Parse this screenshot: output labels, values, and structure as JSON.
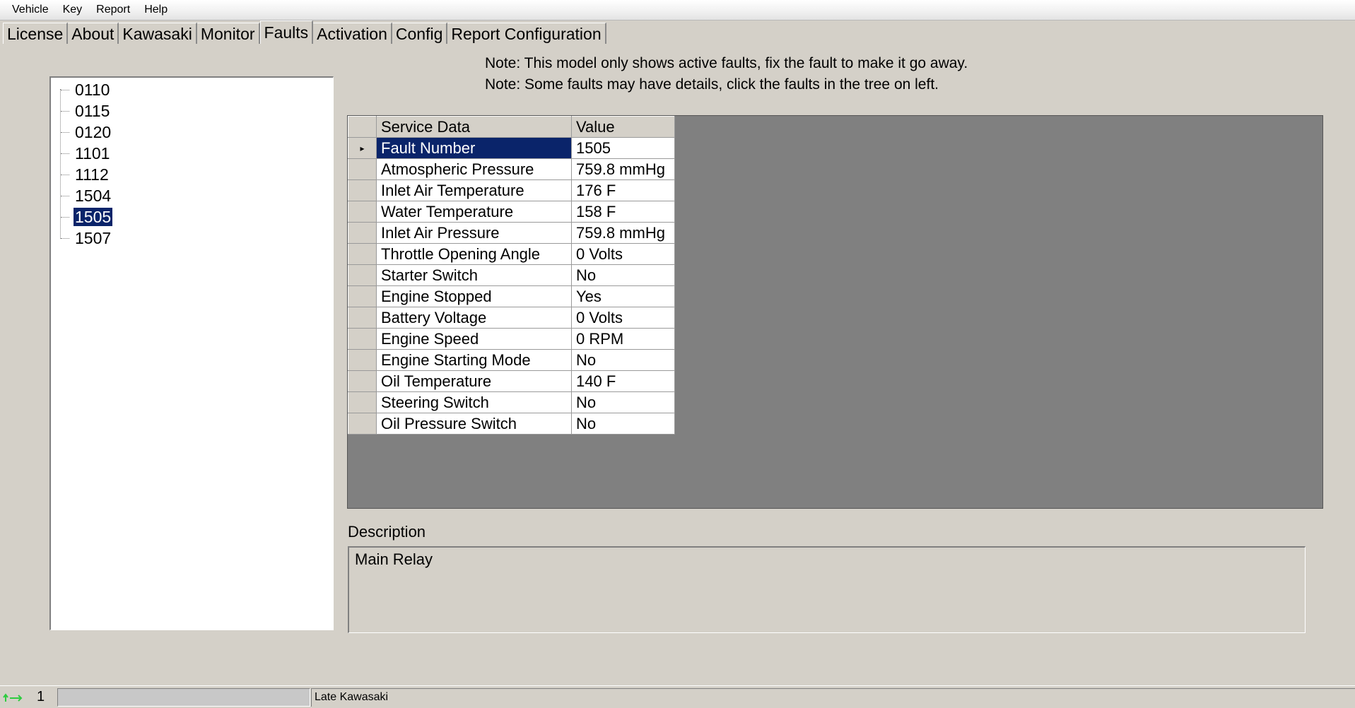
{
  "menu": {
    "items": [
      {
        "label": "Vehicle"
      },
      {
        "label": "Key"
      },
      {
        "label": "Report"
      },
      {
        "label": "Help"
      }
    ]
  },
  "tabs": [
    {
      "label": "License"
    },
    {
      "label": "About"
    },
    {
      "label": "Kawasaki"
    },
    {
      "label": "Monitor"
    },
    {
      "label": "Faults",
      "active": true
    },
    {
      "label": "Activation"
    },
    {
      "label": "Config"
    },
    {
      "label": "Report Configuration"
    }
  ],
  "tree": {
    "nodes": [
      "0110",
      "0115",
      "0120",
      "1101",
      "1112",
      "1504",
      "1505",
      "1507"
    ],
    "selected": "1505"
  },
  "notes": [
    "Note: This model only shows active faults, fix the fault to make it go away.",
    "Note: Some faults may have details, click the faults in the tree on left."
  ],
  "grid": {
    "headers": {
      "service": "Service Data",
      "value": "Value"
    },
    "rows": [
      [
        "Fault Number",
        "1505"
      ],
      [
        "Atmospheric Pressure",
        "759.8 mmHg"
      ],
      [
        "Inlet Air Temperature",
        "176 F"
      ],
      [
        "Water Temperature",
        "158 F"
      ],
      [
        "Inlet Air Pressure",
        "759.8 mmHg"
      ],
      [
        "Throttle Opening Angle",
        "0 Volts"
      ],
      [
        "Starter Switch",
        "No"
      ],
      [
        "Engine Stopped",
        "Yes"
      ],
      [
        "Battery Voltage",
        "0 Volts"
      ],
      [
        "Engine Speed",
        "0 RPM"
      ],
      [
        "Engine Starting Mode",
        "No"
      ],
      [
        "Oil Temperature",
        "140 F"
      ],
      [
        "Steering Switch",
        "No"
      ],
      [
        "Oil Pressure Switch",
        "No"
      ]
    ],
    "selected_row": 0
  },
  "description": {
    "label": "Description",
    "text": "Main Relay"
  },
  "status": {
    "icon": "connection-arrows-icon",
    "count": "1",
    "text": "Late Kawasaki"
  }
}
